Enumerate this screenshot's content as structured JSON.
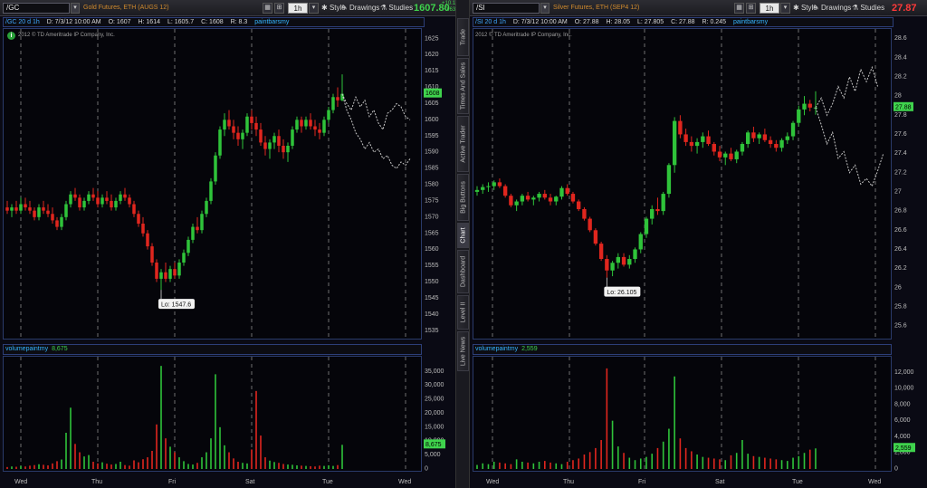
{
  "left": {
    "symbol": "/GC",
    "description": "Gold Futures, ETH (AUGS 12)",
    "interval": "1h",
    "style_label": "Style",
    "drawings_label": "Drawings",
    "studies_label": "Studies",
    "last_price": "1607.80",
    "net_change": "+10.10",
    "net_change_pct": "+0.63%",
    "info": {
      "symbol_tf": "/GC 20 d 1h",
      "date": "D: 7/3/12 10:00 AM",
      "open": "O: 1607",
      "high": "H: 1614",
      "low": "L: 1605.7",
      "close": "C: 1608",
      "range": "R: 8.3",
      "study": "paintbarsmy"
    },
    "copyright": "2012 © TD Ameritrade IP Company, Inc.",
    "low_label": "Lo: 1547.6",
    "price_tag": "1608",
    "volume_study": "volumepaintmy",
    "volume_value": "8,675",
    "volume_tag": "8,675",
    "price_ticks": [
      "1625",
      "1620",
      "1615",
      "1610",
      "1605",
      "1600",
      "1595",
      "1590",
      "1585",
      "1580",
      "1575",
      "1570",
      "1565",
      "1560",
      "1555",
      "1550",
      "1545",
      "1540",
      "1535"
    ],
    "volume_ticks": [
      "35,000",
      "30,000",
      "25,000",
      "20,000",
      "15,000",
      "10,000",
      "5,000",
      "0"
    ],
    "x_labels": [
      "Wed",
      "Thu",
      "Fri",
      "Sat",
      "Tue",
      "Wed"
    ]
  },
  "right": {
    "symbol": "/SI",
    "description": "Silver Futures, ETH (SEP4 12)",
    "interval": "1h",
    "style_label": "Style",
    "drawings_label": "Drawings",
    "studies_label": "Studies",
    "last_price": "27.87",
    "info": {
      "symbol_tf": "/SI 20 d 1h",
      "date": "D: 7/3/12 10:00 AM",
      "open": "O: 27.88",
      "high": "H: 28.05",
      "low": "L: 27.805",
      "close": "C: 27.88",
      "range": "R: 0.245",
      "study": "paintbarsmy"
    },
    "copyright": "2012 © TD Ameritrade IP Company, Inc.",
    "low_label": "Lo: 26.105",
    "price_tag": "27.88",
    "volume_study": "volumepaintmy",
    "volume_value": "2,559",
    "volume_tag": "2,559",
    "price_ticks": [
      "28.6",
      "28.4",
      "28.2",
      "28",
      "27.8",
      "27.6",
      "27.4",
      "27.2",
      "27",
      "26.8",
      "26.6",
      "26.4",
      "26.2",
      "26",
      "25.8",
      "25.6"
    ],
    "volume_ticks": [
      "12,000",
      "10,000",
      "8,000",
      "6,000",
      "4,000",
      "2,000",
      "0"
    ],
    "x_labels": [
      "Wed",
      "Thu",
      "Fri",
      "Sat",
      "Tue",
      "Wed"
    ]
  },
  "side_tabs": [
    "Trade",
    "Times And Sales",
    "Active Trader",
    "Big Buttons",
    "Chart",
    "Dashboard",
    "Level II",
    "Live News"
  ],
  "colors": {
    "up": "#2fc33a",
    "down": "#e0261e",
    "forecast": "#c8c8c8",
    "grid": "#8a8a8a",
    "accent": "#35b6ff",
    "last_price": "#3fd34d",
    "last_price_silver": "#ff3a3a"
  },
  "chart_data": [
    {
      "type": "candlestick",
      "symbol": "/GC",
      "ylim": [
        1532,
        1628
      ],
      "ohlc": [
        [
          1573,
          1575,
          1571,
          1572
        ],
        [
          1572,
          1574,
          1570,
          1573
        ],
        [
          1573,
          1575,
          1571,
          1572
        ],
        [
          1572,
          1576,
          1571,
          1574
        ],
        [
          1574,
          1576,
          1572,
          1573
        ],
        [
          1573,
          1575,
          1571,
          1572
        ],
        [
          1572,
          1573,
          1569,
          1570
        ],
        [
          1570,
          1574,
          1569,
          1573
        ],
        [
          1573,
          1575,
          1571,
          1572
        ],
        [
          1572,
          1574,
          1570,
          1571
        ],
        [
          1571,
          1573,
          1568,
          1569
        ],
        [
          1569,
          1570,
          1566,
          1567
        ],
        [
          1567,
          1571,
          1566,
          1570
        ],
        [
          1570,
          1575,
          1569,
          1574
        ],
        [
          1574,
          1578,
          1573,
          1577
        ],
        [
          1577,
          1579,
          1575,
          1576
        ],
        [
          1576,
          1577,
          1572,
          1573
        ],
        [
          1573,
          1576,
          1572,
          1575
        ],
        [
          1575,
          1578,
          1574,
          1577
        ],
        [
          1577,
          1579,
          1575,
          1576
        ],
        [
          1576,
          1578,
          1573,
          1574
        ],
        [
          1574,
          1577,
          1573,
          1576
        ],
        [
          1576,
          1578,
          1574,
          1575
        ],
        [
          1575,
          1577,
          1572,
          1573
        ],
        [
          1573,
          1576,
          1572,
          1575
        ],
        [
          1575,
          1578,
          1574,
          1577
        ],
        [
          1577,
          1579,
          1575,
          1576
        ],
        [
          1576,
          1577,
          1573,
          1574
        ],
        [
          1574,
          1575,
          1570,
          1571
        ],
        [
          1571,
          1572,
          1567,
          1568
        ],
        [
          1568,
          1570,
          1564,
          1565
        ],
        [
          1565,
          1566,
          1560,
          1561
        ],
        [
          1561,
          1562,
          1555,
          1556
        ],
        [
          1556,
          1557,
          1550,
          1551
        ],
        [
          1551,
          1554,
          1547.6,
          1553
        ],
        [
          1553,
          1556,
          1550,
          1551
        ],
        [
          1551,
          1555,
          1550,
          1554
        ],
        [
          1554,
          1556,
          1551,
          1552
        ],
        [
          1552,
          1557,
          1551,
          1556
        ],
        [
          1556,
          1560,
          1555,
          1559
        ],
        [
          1559,
          1564,
          1558,
          1563
        ],
        [
          1563,
          1568,
          1562,
          1567
        ],
        [
          1567,
          1570,
          1565,
          1566
        ],
        [
          1566,
          1572,
          1565,
          1571
        ],
        [
          1571,
          1576,
          1570,
          1575
        ],
        [
          1575,
          1582,
          1574,
          1581
        ],
        [
          1581,
          1590,
          1580,
          1589
        ],
        [
          1589,
          1598,
          1588,
          1597
        ],
        [
          1597,
          1602,
          1595,
          1600
        ],
        [
          1600,
          1603,
          1597,
          1598
        ],
        [
          1598,
          1600,
          1594,
          1596
        ],
        [
          1596,
          1598,
          1592,
          1594
        ],
        [
          1594,
          1597,
          1591,
          1596
        ],
        [
          1596,
          1602,
          1595,
          1601
        ],
        [
          1601,
          1603,
          1597,
          1599
        ],
        [
          1599,
          1601,
          1595,
          1597
        ],
        [
          1597,
          1599,
          1592,
          1593
        ],
        [
          1593,
          1595,
          1589,
          1591
        ],
        [
          1591,
          1594,
          1588,
          1593
        ],
        [
          1593,
          1596,
          1591,
          1595
        ],
        [
          1595,
          1597,
          1590,
          1592
        ],
        [
          1592,
          1594,
          1588,
          1590
        ],
        [
          1590,
          1593,
          1587,
          1592
        ],
        [
          1592,
          1598,
          1591,
          1597
        ],
        [
          1597,
          1601,
          1596,
          1600
        ],
        [
          1600,
          1601,
          1596,
          1598
        ],
        [
          1598,
          1601,
          1597,
          1600
        ],
        [
          1600,
          1602,
          1597,
          1598
        ],
        [
          1598,
          1600,
          1595,
          1597
        ],
        [
          1597,
          1599,
          1594,
          1596
        ],
        [
          1596,
          1601,
          1595,
          1600
        ],
        [
          1600,
          1604,
          1599,
          1603
        ],
        [
          1603,
          1608,
          1602,
          1607
        ],
        [
          1607,
          1610,
          1604,
          1606
        ],
        [
          1606,
          1614,
          1605.7,
          1608
        ]
      ],
      "forecast": [
        [
          1608,
          1605,
          1603,
          1607,
          1604,
          1606,
          1601,
          1603,
          1599,
          1597,
          1602,
          1603,
          1605,
          1604,
          1601,
          1600
        ],
        [
          1608,
          1603,
          1600,
          1596,
          1594,
          1591,
          1593,
          1590,
          1591,
          1588,
          1589,
          1586,
          1585,
          1587,
          1586,
          1588
        ]
      ],
      "volume": [
        700,
        900,
        800,
        1100,
        900,
        1200,
        1400,
        1700,
        1500,
        1300,
        2000,
        2800,
        3400,
        13000,
        22000,
        9000,
        6000,
        4500,
        5000,
        2600,
        2000,
        2400,
        1900,
        1600,
        1800,
        2600,
        1400,
        1200,
        3100,
        2400,
        3500,
        4200,
        6500,
        16000,
        37000,
        11000,
        8000,
        6000,
        4200,
        2800,
        1800,
        1600,
        2200,
        4200,
        6000,
        11000,
        34000,
        15000,
        8500,
        6000,
        3800,
        2600,
        2200,
        2000,
        7000,
        28000,
        12000,
        4200,
        3000,
        2500,
        2200,
        1800,
        1600,
        1500,
        1300,
        1200,
        1100,
        1000,
        900,
        1200,
        1100,
        1300,
        1100,
        1400,
        8675
      ]
    },
    {
      "type": "candlestick",
      "symbol": "/SI",
      "ylim": [
        25.45,
        28.7
      ],
      "ohlc": [
        [
          27.0,
          27.06,
          26.96,
          27.02
        ],
        [
          27.02,
          27.08,
          26.98,
          27.05
        ],
        [
          27.05,
          27.1,
          27.0,
          27.06
        ],
        [
          27.06,
          27.12,
          27.02,
          27.1
        ],
        [
          27.1,
          27.14,
          27.04,
          27.06
        ],
        [
          27.06,
          27.08,
          26.94,
          26.96
        ],
        [
          26.96,
          26.98,
          26.84,
          26.86
        ],
        [
          26.86,
          26.92,
          26.8,
          26.9
        ],
        [
          26.9,
          26.98,
          26.86,
          26.96
        ],
        [
          26.96,
          27.0,
          26.9,
          26.92
        ],
        [
          26.92,
          26.96,
          26.86,
          26.94
        ],
        [
          26.94,
          27.0,
          26.9,
          26.98
        ],
        [
          26.98,
          27.02,
          26.92,
          26.94
        ],
        [
          26.94,
          26.98,
          26.86,
          26.9
        ],
        [
          26.9,
          26.96,
          26.86,
          26.95
        ],
        [
          26.95,
          27.06,
          26.92,
          27.04
        ],
        [
          27.04,
          27.08,
          26.96,
          26.98
        ],
        [
          26.98,
          27.0,
          26.88,
          26.9
        ],
        [
          26.9,
          26.92,
          26.8,
          26.82
        ],
        [
          26.82,
          26.84,
          26.7,
          26.72
        ],
        [
          26.72,
          26.74,
          26.58,
          26.6
        ],
        [
          26.6,
          26.62,
          26.44,
          26.46
        ],
        [
          26.46,
          26.48,
          26.28,
          26.3
        ],
        [
          26.3,
          26.34,
          26.105,
          26.18
        ],
        [
          26.18,
          26.28,
          26.12,
          26.26
        ],
        [
          26.26,
          26.36,
          26.2,
          26.32
        ],
        [
          26.32,
          26.36,
          26.22,
          26.24
        ],
        [
          26.24,
          26.34,
          26.2,
          26.3
        ],
        [
          26.3,
          26.42,
          26.26,
          26.4
        ],
        [
          26.4,
          26.58,
          26.36,
          26.56
        ],
        [
          26.56,
          26.74,
          26.52,
          26.72
        ],
        [
          26.72,
          26.86,
          26.66,
          26.82
        ],
        [
          26.82,
          26.94,
          26.76,
          26.8
        ],
        [
          26.8,
          27.0,
          26.76,
          26.98
        ],
        [
          26.98,
          27.3,
          26.94,
          27.28
        ],
        [
          27.28,
          27.78,
          27.2,
          27.74
        ],
        [
          27.74,
          27.8,
          27.56,
          27.6
        ],
        [
          27.6,
          27.66,
          27.48,
          27.52
        ],
        [
          27.52,
          27.58,
          27.42,
          27.48
        ],
        [
          27.48,
          27.56,
          27.4,
          27.52
        ],
        [
          27.52,
          27.62,
          27.46,
          27.58
        ],
        [
          27.58,
          27.64,
          27.48,
          27.5
        ],
        [
          27.5,
          27.52,
          27.38,
          27.42
        ],
        [
          27.42,
          27.48,
          27.32,
          27.36
        ],
        [
          27.36,
          27.42,
          27.28,
          27.4
        ],
        [
          27.4,
          27.46,
          27.32,
          27.34
        ],
        [
          27.34,
          27.44,
          27.3,
          27.42
        ],
        [
          27.42,
          27.52,
          27.38,
          27.5
        ],
        [
          27.5,
          27.64,
          27.46,
          27.62
        ],
        [
          27.62,
          27.68,
          27.52,
          27.56
        ],
        [
          27.56,
          27.62,
          27.5,
          27.6
        ],
        [
          27.6,
          27.66,
          27.52,
          27.54
        ],
        [
          27.54,
          27.58,
          27.46,
          27.5
        ],
        [
          27.5,
          27.54,
          27.42,
          27.46
        ],
        [
          27.46,
          27.56,
          27.42,
          27.54
        ],
        [
          27.54,
          27.62,
          27.5,
          27.58
        ],
        [
          27.58,
          27.74,
          27.54,
          27.72
        ],
        [
          27.72,
          27.9,
          27.68,
          27.86
        ],
        [
          27.86,
          28.0,
          27.8,
          27.92
        ],
        [
          27.92,
          27.96,
          27.84,
          27.88
        ],
        [
          27.88,
          28.05,
          27.805,
          27.88
        ]
      ],
      "forecast": [
        [
          27.88,
          27.98,
          27.8,
          27.92,
          28.1,
          27.98,
          28.2,
          28.05,
          28.28,
          28.15,
          28.3,
          28.1
        ],
        [
          27.88,
          27.7,
          27.5,
          27.62,
          27.35,
          27.42,
          27.2,
          27.28,
          27.08,
          27.14,
          27.06,
          27.22,
          27.4
        ]
      ],
      "volume": [
        500,
        700,
        600,
        900,
        800,
        700,
        600,
        1200,
        900,
        800,
        700,
        900,
        1000,
        800,
        700,
        600,
        900,
        1100,
        1300,
        1800,
        2100,
        2600,
        3600,
        12500,
        6000,
        2800,
        2000,
        1400,
        1100,
        1300,
        1500,
        1900,
        2600,
        3400,
        5000,
        11500,
        3800,
        2600,
        2200,
        1800,
        1500,
        1400,
        1300,
        1200,
        1100,
        1700,
        2000,
        3600,
        1900,
        1600,
        1500,
        1400,
        1300,
        1200,
        1100,
        1000,
        1400,
        1600,
        2000,
        2400,
        2559
      ]
    }
  ]
}
